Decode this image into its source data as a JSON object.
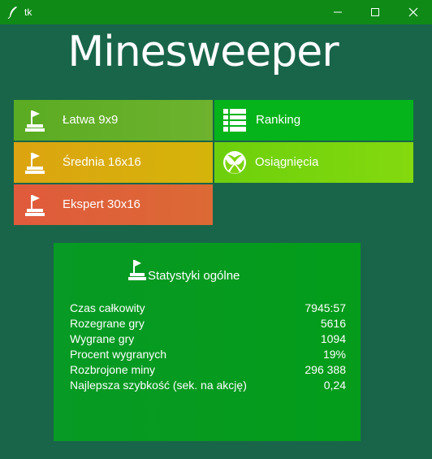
{
  "window": {
    "title": "tk",
    "icons": {
      "app": "feather-icon",
      "minimize": "minimize-icon",
      "maximize": "maximize-icon",
      "close": "close-icon"
    }
  },
  "app": {
    "heading": "Minesweeper"
  },
  "tiles": [
    {
      "label": "Łatwa 9x9",
      "icon": "flag-icon",
      "color": "#6ab02a"
    },
    {
      "label": "Ranking",
      "icon": "list-icon",
      "color": "#05b41a"
    },
    {
      "label": "Średnia 16x16",
      "icon": "flag-icon",
      "color": "#d8ac0c"
    },
    {
      "label": "Osiągnięcia",
      "icon": "xbox-icon",
      "color": "#7dd40c"
    },
    {
      "label": "Ekspert 30x16",
      "icon": "flag-icon",
      "color": "#e0603a"
    }
  ],
  "stats": {
    "title": "Statystyki ogólne",
    "icon": "flag-icon",
    "rows": [
      {
        "label": "Czas całkowity",
        "value": "7945:57"
      },
      {
        "label": "Rozegrane gry",
        "value": "5616"
      },
      {
        "label": "Wygrane gry",
        "value": "1094"
      },
      {
        "label": "Procent wygranych",
        "value": "19%"
      },
      {
        "label": "Rozbrojone miny",
        "value": "296 388"
      },
      {
        "label": "Najlepsza szybkość (sek. na akcję)",
        "value": "0,24"
      }
    ]
  },
  "colors": {
    "background": "#19654a",
    "titlebar": "#0f8a17",
    "stats_panel": "#079a24"
  }
}
